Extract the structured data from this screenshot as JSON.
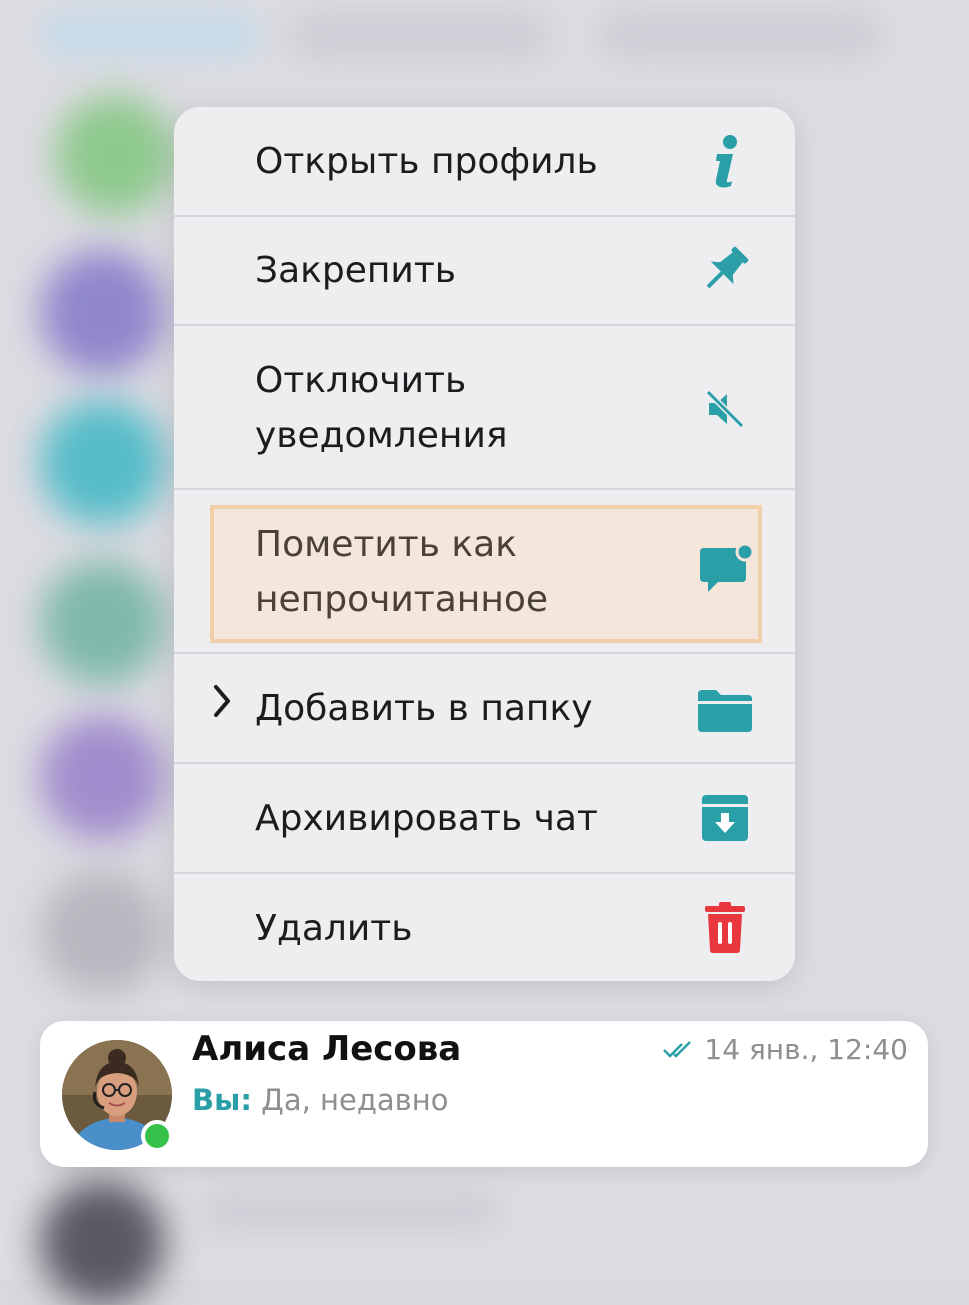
{
  "menu": {
    "items": [
      {
        "label": "Открыть профиль",
        "icon": "info-icon"
      },
      {
        "label": "Закрепить",
        "icon": "pin-icon"
      },
      {
        "label_line1": "Отключить",
        "label_line2": "уведомления",
        "icon": "mute-icon"
      },
      {
        "label_line1": "Пометить как",
        "label_line2": "непрочитанное",
        "icon": "unread-chat-icon",
        "highlighted": true
      },
      {
        "label": "Добавить в папку",
        "icon": "folder-icon",
        "has_submenu": true
      },
      {
        "label": "Архивировать чат",
        "icon": "archive-icon"
      },
      {
        "label": "Удалить",
        "icon": "trash-icon",
        "destructive": true
      }
    ]
  },
  "chat": {
    "name": "Алиса Лесова",
    "time": "14 янв., 12:40",
    "sender": "Вы:",
    "message": "Да, недавно",
    "online": true
  },
  "colors": {
    "accent": "#2a9fa8",
    "destructive": "#e8383d",
    "highlight_fill": "#f4e6da",
    "highlight_border": "#f0cfaa"
  }
}
